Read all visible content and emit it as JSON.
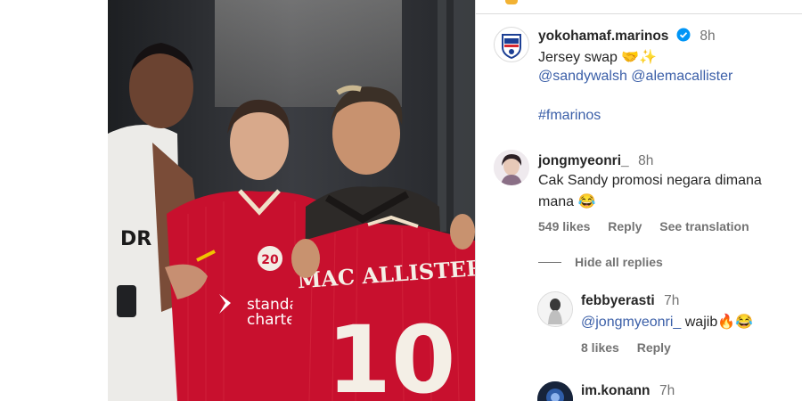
{
  "post": {
    "author": "yokohamaf.marinos",
    "time": "8h",
    "caption_text": "Jersey swap",
    "caption_emoji": "🤝✨",
    "mention_1": "@sandywalsh",
    "mention_2": "@alemacallister",
    "hashtag": "#fmarinos"
  },
  "photo": {
    "sponsor_line_1": "standard",
    "sponsor_line_2": "charter",
    "badge_text": "20",
    "back_name": "MAC ALLISTER",
    "back_number": "10"
  },
  "comments": [
    {
      "user": "jongmyeonri_",
      "time": "8h",
      "text_line_1": "Cak Sandy promosi negara dimana",
      "text_line_2": "mana",
      "emoji": "😂",
      "likes": "549 likes",
      "reply": "Reply",
      "translate": "See translation",
      "hide_replies": "Hide all replies"
    },
    {
      "user": "febbyerasti",
      "time": "7h",
      "mention": "@jongmyeonri_",
      "text": "wajib",
      "emoji": "🔥😂",
      "likes": "8 likes",
      "reply": "Reply"
    },
    {
      "user": "im.konann",
      "time": "7h"
    }
  ],
  "colors": {
    "link": "#3b5fa8",
    "verified": "#0095f6",
    "jersey_red": "#c8102e"
  }
}
